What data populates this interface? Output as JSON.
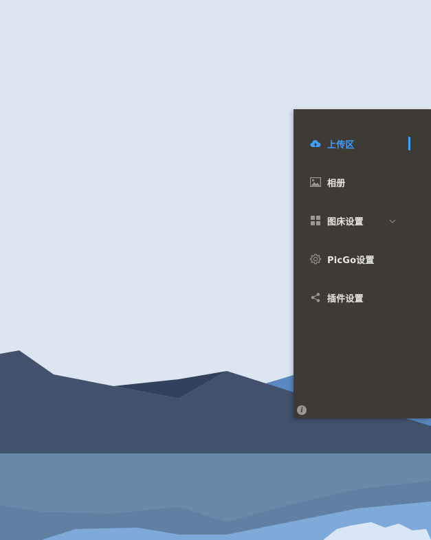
{
  "menu": {
    "items": [
      {
        "label": "上传区",
        "icon": "cloud-upload-icon",
        "active": true
      },
      {
        "label": "相册",
        "icon": "image-icon"
      },
      {
        "label": "图床设置",
        "icon": "grid-icon",
        "has_submenu": true
      },
      {
        "label": "PicGo设置",
        "icon": "gear-icon"
      },
      {
        "label": "插件设置",
        "icon": "share-icon"
      }
    ]
  },
  "info_glyph": "i",
  "colors": {
    "accent": "#409eff",
    "panel_bg": "#3e3b37",
    "menu_text": "#e8e6e3",
    "icon_gray": "#9a9894",
    "sky": "#dce6f1",
    "mountains": "#42526c",
    "water": "#6889a8"
  }
}
